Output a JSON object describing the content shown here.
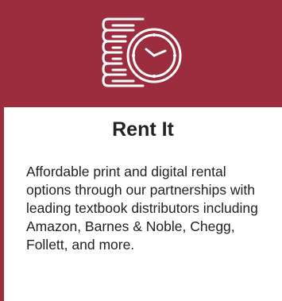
{
  "card": {
    "icon": "book-stack-clock-icon",
    "title": "Rent It",
    "description": "Affordable print and digital rental options through our partnerships with leading textbook distributors including Amazon, Barnes & Noble, Chegg, Follett, and more."
  },
  "colors": {
    "accent": "#9b2d3f",
    "icon_stroke": "#ffffff",
    "text": "#222222",
    "background": "#ffffff"
  }
}
